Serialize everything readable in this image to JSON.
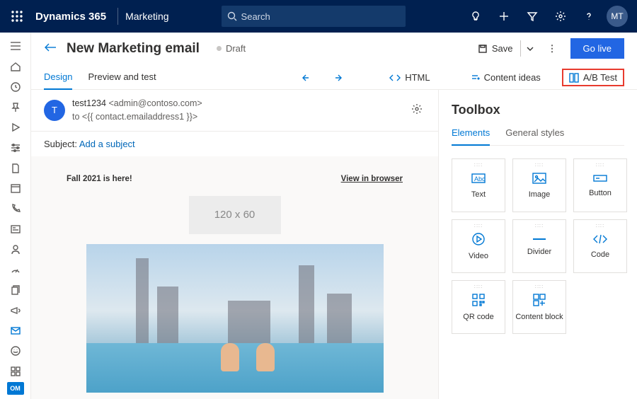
{
  "topbar": {
    "brand": "Dynamics 365",
    "module": "Marketing",
    "search_placeholder": "Search",
    "avatar_initials": "MT"
  },
  "header": {
    "title": "New Marketing email",
    "status": "Draft",
    "save_label": "Save",
    "golive_label": "Go live"
  },
  "tabs": {
    "design": "Design",
    "preview": "Preview and test",
    "html": "HTML",
    "content_ideas": "Content ideas",
    "ab_test": "A/B Test"
  },
  "envelope": {
    "avatar_letter": "T",
    "from_name": "test1234",
    "from_email": "<admin@contoso.com>",
    "to_line": "to  <{{ contact.emailaddress1 }}>",
    "subject_label": "Subject:",
    "subject_placeholder": "Add a subject"
  },
  "email_body": {
    "headline": "Fall 2021 is here!",
    "view_in_browser": "View in browser",
    "placeholder_dims": "120 x 60"
  },
  "toolbox": {
    "title": "Toolbox",
    "tabs": {
      "elements": "Elements",
      "general": "General styles"
    },
    "items": {
      "text": "Text",
      "image": "Image",
      "button": "Button",
      "video": "Video",
      "divider": "Divider",
      "code": "Code",
      "qr": "QR code",
      "content_block": "Content block"
    }
  },
  "nav": {
    "om_badge": "OM"
  }
}
